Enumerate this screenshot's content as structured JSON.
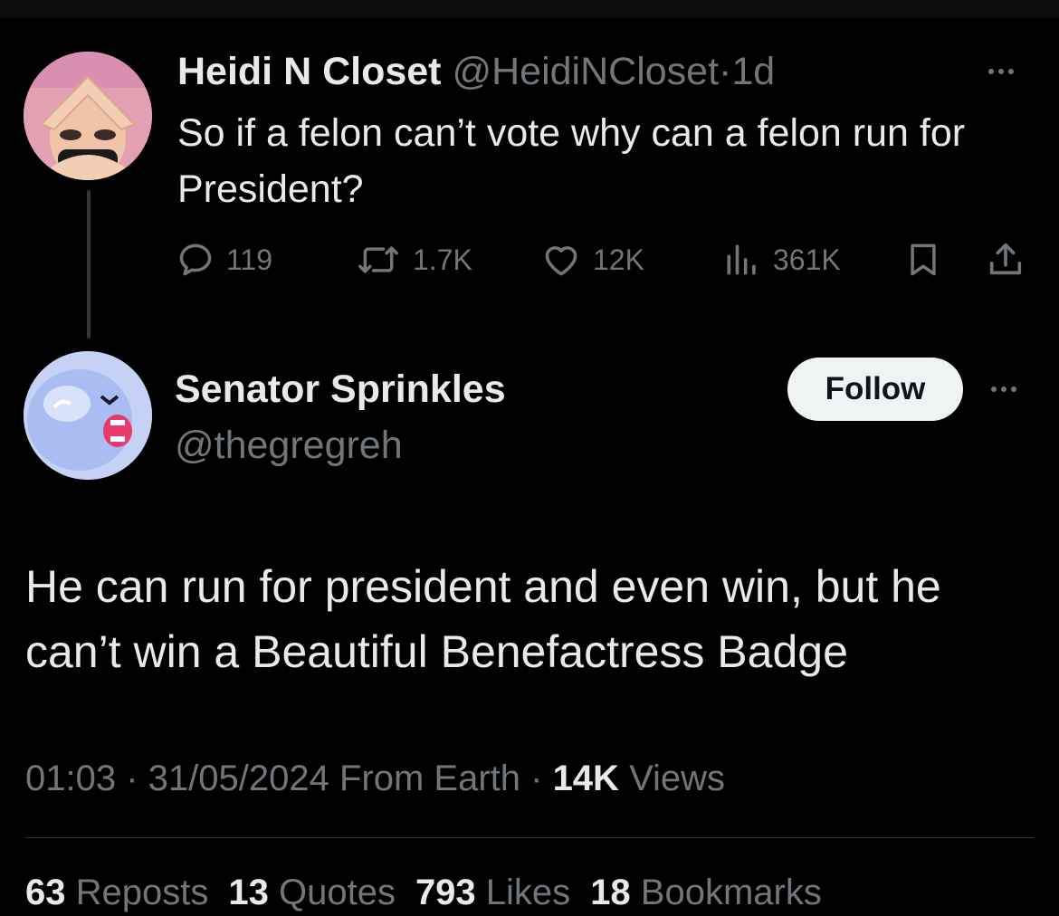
{
  "colors": {
    "background": "#000000",
    "text_primary": "#e7e9ea",
    "text_secondary": "#71767b",
    "follow_button_bg": "#eff3f4",
    "follow_button_text": "#0f1419",
    "divider": "#2f3336"
  },
  "parent_tweet": {
    "display_name": "Heidi N Closet",
    "handle": "@HeidiNCloset",
    "separator": "·",
    "time": "1d",
    "text": "So if a felon can’t vote why can a felon run for President?",
    "more_icon": "more-horizontal-icon",
    "actions": {
      "replies": "119",
      "reposts": "1.7K",
      "likes": "12K",
      "views": "361K"
    }
  },
  "reply_tweet": {
    "display_name": "Senator Sprinkles",
    "handle": "@thegregreh",
    "follow_label": "Follow",
    "more_icon": "more-horizontal-icon",
    "text": "He can run for president and even win, but he can’t win a Beautiful Benefactress Badge",
    "meta": {
      "time": "01:03",
      "sep1": " · ",
      "date": "31/05/2024",
      "source": " From Earth",
      "sep2": " · ",
      "views_count": "14K",
      "views_label": " Views"
    },
    "stats": {
      "reposts_count": "63",
      "reposts_label": " Reposts",
      "quotes_count": "13",
      "quotes_label": " Quotes",
      "likes_count": "793",
      "likes_label": " Likes",
      "bookmarks_count": "18",
      "bookmarks_label": " Bookmarks"
    }
  }
}
